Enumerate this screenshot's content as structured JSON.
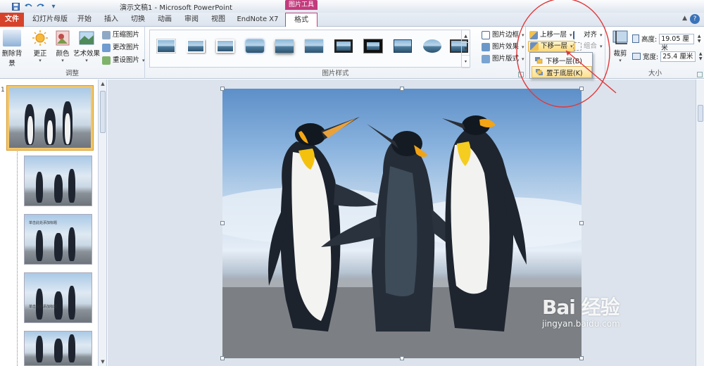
{
  "window": {
    "title": "演示文稿1 - Microsoft PowerPoint"
  },
  "tabs": {
    "context_group": "图片工具",
    "file": "文件",
    "slide_master": "幻灯片母版",
    "home": "开始",
    "insert": "插入",
    "transitions": "切换",
    "animations": "动画",
    "review": "审阅",
    "view": "视图",
    "endnote": "EndNote X7",
    "format": "格式"
  },
  "ribbon": {
    "adjust": {
      "label": "调整",
      "remove_bg": "删除背景",
      "corrections": "更正",
      "color": "颜色",
      "artistic": "艺术效果",
      "compress": "压缩图片",
      "change": "更改图片",
      "reset": "重设图片"
    },
    "picture_styles": {
      "label": "图片样式",
      "border": "图片边框",
      "effects": "图片效果",
      "layout": "图片版式"
    },
    "arrange": {
      "bring_forward": "上移一层",
      "send_backward": "下移一层",
      "align": "对齐",
      "group": "组合"
    },
    "size": {
      "label": "大小",
      "crop": "裁剪",
      "height_label": "高度:",
      "height_value": "19.05 厘米",
      "width_label": "宽度:",
      "width_value": "25.4 厘米"
    }
  },
  "dropdown": {
    "items": [
      {
        "label": "下移一层(B)"
      },
      {
        "label": "置于底层(K)"
      }
    ]
  },
  "slides": {
    "first_number": "1",
    "thumb_text": "单击此处添加标题"
  },
  "watermark": {
    "logo": "Bai 经验",
    "url": "jingyan.baidu.com"
  },
  "colors": {
    "file_tab": "#d7432a",
    "context_tab": "#c23b7d",
    "annotation": "#e0383a",
    "selection": "#f3c668"
  }
}
